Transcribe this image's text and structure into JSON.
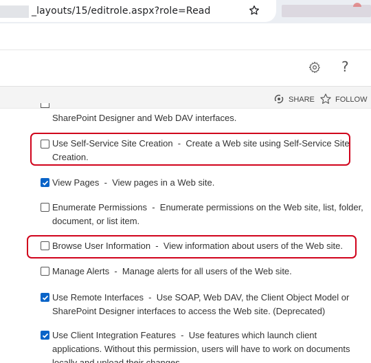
{
  "browser": {
    "url": "_layouts/15/editrole.aspx?role=Read"
  },
  "actions": {
    "share_label": "SHARE",
    "follow_label": "FOLLOW"
  },
  "permissions": [
    {
      "label": "",
      "description": "SharePoint Designer and Web DAV interfaces.",
      "checked": false
    },
    {
      "label": "Use Self-Service Site Creation",
      "description": "Create a Web site using Self-Service Site Creation.",
      "checked": false,
      "highlighted": true
    },
    {
      "label": "View Pages",
      "description": "View pages in a Web site.",
      "checked": true
    },
    {
      "label": "Enumerate Permissions",
      "description": "Enumerate permissions on the Web site, list, folder, document, or list item.",
      "checked": false
    },
    {
      "label": "Browse User Information",
      "description": "View information about users of the Web site.",
      "checked": false,
      "highlighted": true
    },
    {
      "label": "Manage Alerts",
      "description": "Manage alerts for all users of the Web site.",
      "checked": false
    },
    {
      "label": "Use Remote Interfaces",
      "description": "Use SOAP, Web DAV, the Client Object Model or SharePoint Designer interfaces to access the Web site. (Deprecated)",
      "checked": true
    },
    {
      "label": "Use Client Integration Features",
      "description": "Use features which launch client applications. Without this permission, users will have to work on documents locally and upload their changes.",
      "checked": true
    }
  ],
  "separator": "  -  ",
  "colors": {
    "checkbox_checked": "#0a64c8",
    "highlight": "#d0021b"
  }
}
